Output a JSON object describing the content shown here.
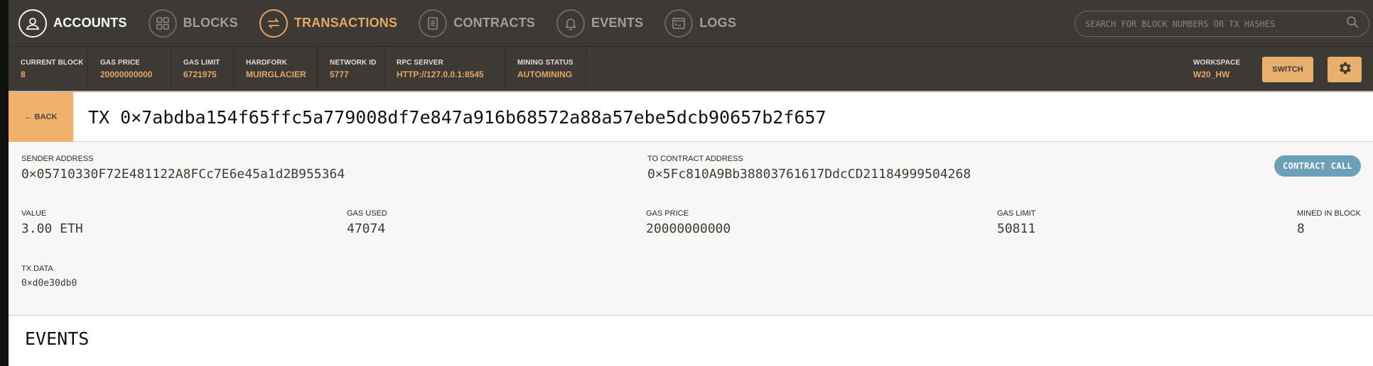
{
  "nav": {
    "items": [
      {
        "label": "ACCOUNTS",
        "icon": "user-icon",
        "state": "active"
      },
      {
        "label": "BLOCKS",
        "icon": "blocks-icon",
        "state": "normal"
      },
      {
        "label": "TRANSACTIONS",
        "icon": "transfer-icon",
        "state": "selected"
      },
      {
        "label": "CONTRACTS",
        "icon": "document-icon",
        "state": "normal"
      },
      {
        "label": "EVENTS",
        "icon": "bell-icon",
        "state": "normal"
      },
      {
        "label": "LOGS",
        "icon": "terminal-icon",
        "state": "normal"
      }
    ],
    "search_placeholder": "SEARCH FOR BLOCK NUMBERS OR TX HASHES"
  },
  "status": {
    "current_block": {
      "label": "CURRENT BLOCK",
      "value": "8"
    },
    "gas_price": {
      "label": "GAS PRICE",
      "value": "20000000000"
    },
    "gas_limit": {
      "label": "GAS LIMIT",
      "value": "6721975"
    },
    "hardfork": {
      "label": "HARDFORK",
      "value": "MUIRGLACIER"
    },
    "network_id": {
      "label": "NETWORK ID",
      "value": "5777"
    },
    "rpc_server": {
      "label": "RPC SERVER",
      "value": "HTTP://127.0.0.1:8545"
    },
    "mining_status": {
      "label": "MINING STATUS",
      "value": "AUTOMINING"
    },
    "workspace": {
      "label": "WORKSPACE",
      "value": "W20_HW"
    },
    "switch_label": "SWITCH"
  },
  "tx": {
    "back_label": "← BACK",
    "title": "TX 0×7abdba154f65ffc5a779008df7e847a916b68572a88a57ebe5dcb90657b2f657",
    "sender": {
      "label": "SENDER ADDRESS",
      "value": "0×05710330F72E481122A8FCc7E6e45a1d2B955364"
    },
    "to": {
      "label": "TO CONTRACT ADDRESS",
      "value": "0×5Fc810A9Bb38803761617DdcCD21184999504268"
    },
    "badge": "CONTRACT CALL",
    "value": {
      "label": "VALUE",
      "value": "3.00 ETH"
    },
    "gas_used": {
      "label": "GAS USED",
      "value": "47074"
    },
    "gas_price": {
      "label": "GAS PRICE",
      "value": "20000000000"
    },
    "gas_limit": {
      "label": "GAS LIMIT",
      "value": "50811"
    },
    "mined_in_block": {
      "label": "MINED IN BLOCK",
      "value": "8"
    },
    "tx_data": {
      "label": "TX DATA",
      "value": "0×d0e30db0"
    }
  },
  "events": {
    "title": "EVENTS"
  },
  "colors": {
    "nav_bg": "#3d3935",
    "accent": "#e4a663",
    "badge": "#6aa0b8"
  }
}
